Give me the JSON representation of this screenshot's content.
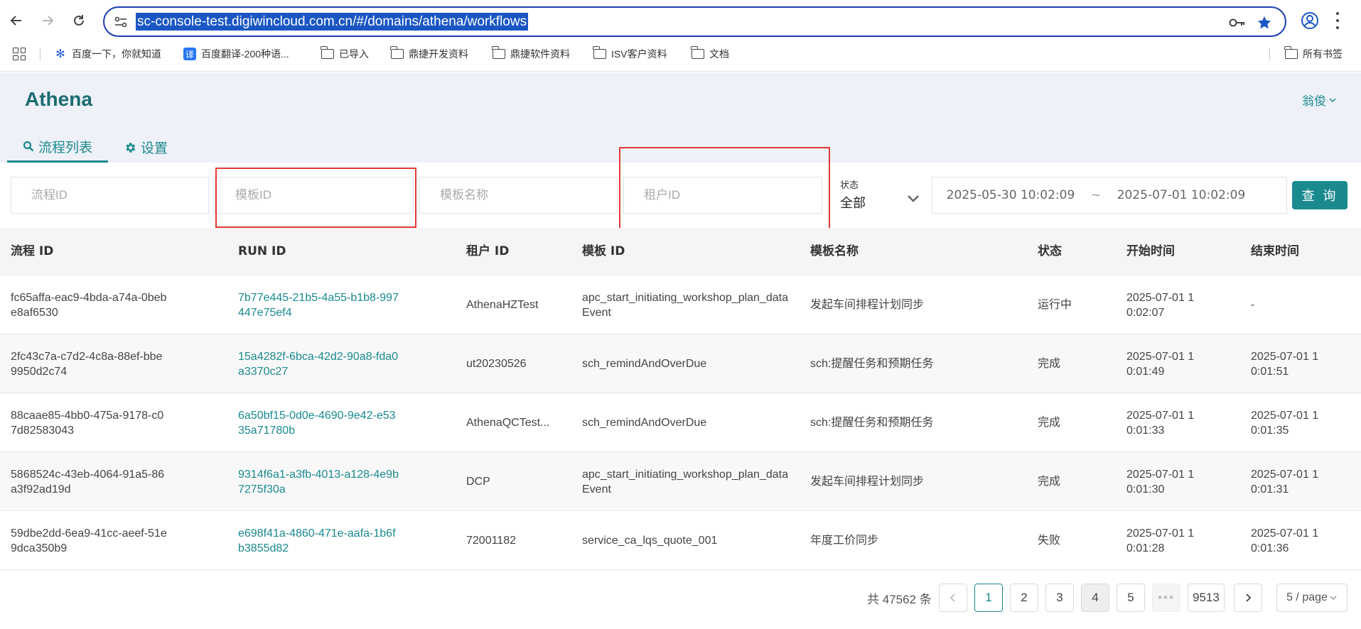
{
  "browser": {
    "url": "sc-console-test.digiwincloud.com.cn/#/domains/athena/workflows",
    "bookmarks": [
      {
        "label": "百度一下，你就知道",
        "icon": "baidu-icon"
      },
      {
        "label": "百度翻译-200种语...",
        "icon": "fanyi-icon",
        "icon_text": "译"
      },
      {
        "label": "已导入",
        "icon": "folder-icon"
      },
      {
        "label": "鼎捷开发资料",
        "icon": "folder-icon"
      },
      {
        "label": "鼎捷软件资料",
        "icon": "folder-icon"
      },
      {
        "label": "ISV客户资料",
        "icon": "folder-icon"
      },
      {
        "label": "文档",
        "icon": "folder-icon"
      }
    ],
    "all_bookmarks": "所有书签"
  },
  "app": {
    "title": "Athena",
    "user": "翁俊",
    "tabs": [
      {
        "label": "流程列表",
        "icon": "search-icon",
        "active": true
      },
      {
        "label": "设置",
        "icon": "gear-icon",
        "active": false
      }
    ]
  },
  "filters": {
    "process_id_placeholder": "流程ID",
    "template_id_placeholder": "模板ID",
    "template_name_placeholder": "模板名称",
    "tenant_id_placeholder": "租户ID",
    "status_label": "状态",
    "status_value": "全部",
    "date_start": "2025-05-30 10:02:09",
    "date_separator": "~",
    "date_end": "2025-07-01 10:02:09",
    "query_button": "查 询"
  },
  "table": {
    "columns": [
      "流程 ID",
      "RUN ID",
      "租户 ID",
      "模板 ID",
      "模板名称",
      "状态",
      "开始时间",
      "结束时间"
    ],
    "rows": [
      {
        "process_id": "fc65affa-eac9-4bda-a74a-0bebe8af6530",
        "run_id": "7b77e445-21b5-4a55-b1b8-997447e75ef4",
        "tenant_id": "AthenaHZTest",
        "template_id": "apc_start_initiating_workshop_plan_dataEvent",
        "template_name": "发起车间排程计划同步",
        "status": "运行中",
        "start": "2025-07-01 10:02:07",
        "end": "-"
      },
      {
        "process_id": "2fc43c7a-c7d2-4c8a-88ef-bbe9950d2c74",
        "run_id": "15a4282f-6bca-42d2-90a8-fda0a3370c27",
        "tenant_id": "ut20230526",
        "template_id": "sch_remindAndOverDue",
        "template_name": "sch:提醒任务和预期任务",
        "status": "完成",
        "start": "2025-07-01 10:01:49",
        "end": "2025-07-01 10:01:51"
      },
      {
        "process_id": "88caae85-4bb0-475a-9178-c07d82583043",
        "run_id": "6a50bf15-0d0e-4690-9e42-e5335a71780b",
        "tenant_id": "AthenaQCTest...",
        "template_id": "sch_remindAndOverDue",
        "template_name": "sch:提醒任务和预期任务",
        "status": "完成",
        "start": "2025-07-01 10:01:33",
        "end": "2025-07-01 10:01:35"
      },
      {
        "process_id": "5868524c-43eb-4064-91a5-86a3f92ad19d",
        "run_id": "9314f6a1-a3fb-4013-a128-4e9b7275f30a",
        "tenant_id": "DCP",
        "template_id": "apc_start_initiating_workshop_plan_dataEvent",
        "template_name": "发起车间排程计划同步",
        "status": "完成",
        "start": "2025-07-01 10:01:30",
        "end": "2025-07-01 10:01:31"
      },
      {
        "process_id": "59dbe2dd-6ea9-41cc-aeef-51e9dca350b9",
        "run_id": "e698f41a-4860-471e-aafa-1b6fb3855d82",
        "tenant_id": "72001182",
        "template_id": "service_ca_lqs_quote_001",
        "template_name": "年度工价同步",
        "status": "失败",
        "start": "2025-07-01 10:01:28",
        "end": "2025-07-01 10:01:36"
      }
    ]
  },
  "pagination": {
    "total": "共 47562 条",
    "pages": [
      "1",
      "2",
      "3",
      "4",
      "5"
    ],
    "current_page": "1",
    "ellipsis": "•••",
    "last_page": "9513",
    "page_size": "5 / page"
  },
  "colors": {
    "accent": "#1a8a8e",
    "brand": "#1a6c70",
    "highlight_box": "#e53935",
    "url_selection": "#1a56c4"
  }
}
